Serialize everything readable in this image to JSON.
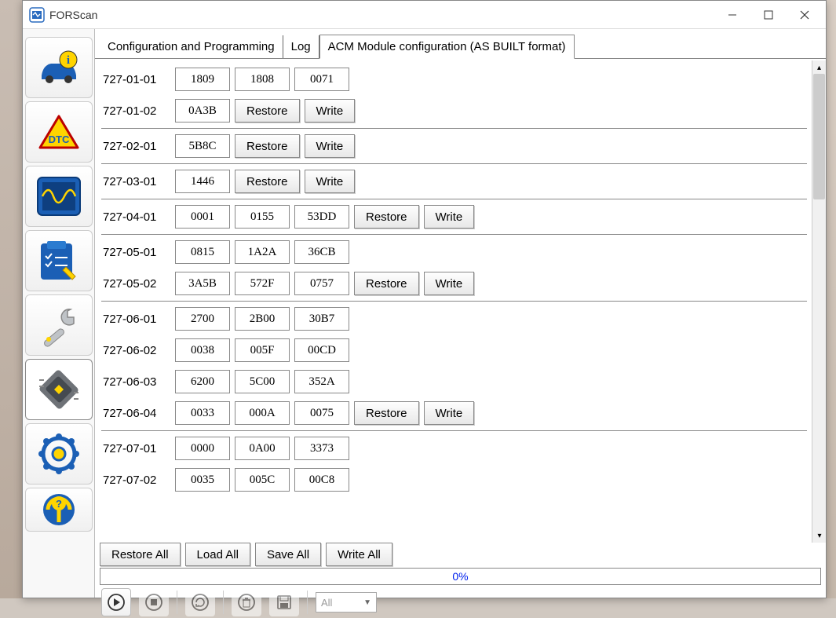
{
  "title": "FORScan",
  "tabs": {
    "config": "Configuration and Programming",
    "log": "Log",
    "acm": "ACM Module configuration (AS BUILT format)"
  },
  "rows": [
    {
      "addr": "727-01-01",
      "vals": [
        "1809",
        "1808",
        "0071"
      ],
      "buttons": []
    },
    {
      "addr": "727-01-02",
      "vals": [
        "0A3B"
      ],
      "buttons": [
        "Restore",
        "Write"
      ],
      "sep": true
    },
    {
      "addr": "727-02-01",
      "vals": [
        "5B8C"
      ],
      "buttons": [
        "Restore",
        "Write"
      ],
      "sep": true
    },
    {
      "addr": "727-03-01",
      "vals": [
        "1446"
      ],
      "buttons": [
        "Restore",
        "Write"
      ],
      "sep": true
    },
    {
      "addr": "727-04-01",
      "vals": [
        "0001",
        "0155",
        "53DD"
      ],
      "buttons": [
        "Restore",
        "Write"
      ],
      "sep": true
    },
    {
      "addr": "727-05-01",
      "vals": [
        "0815",
        "1A2A",
        "36CB"
      ],
      "buttons": []
    },
    {
      "addr": "727-05-02",
      "vals": [
        "3A5B",
        "572F",
        "0757"
      ],
      "buttons": [
        "Restore",
        "Write"
      ],
      "sep": true
    },
    {
      "addr": "727-06-01",
      "vals": [
        "2700",
        "2B00",
        "30B7"
      ],
      "buttons": []
    },
    {
      "addr": "727-06-02",
      "vals": [
        "0038",
        "005F",
        "00CD"
      ],
      "buttons": []
    },
    {
      "addr": "727-06-03",
      "vals": [
        "6200",
        "5C00",
        "352A"
      ],
      "buttons": []
    },
    {
      "addr": "727-06-04",
      "vals": [
        "0033",
        "000A",
        "0075"
      ],
      "buttons": [
        "Restore",
        "Write"
      ],
      "sep": true
    },
    {
      "addr": "727-07-01",
      "vals": [
        "0000",
        "0A00",
        "3373"
      ],
      "buttons": []
    },
    {
      "addr": "727-07-02",
      "vals": [
        "0035",
        "005C",
        "00C8"
      ],
      "buttons": []
    }
  ],
  "bottom": {
    "restore_all": "Restore All",
    "load_all": "Load All",
    "save_all": "Save All",
    "write_all": "Write All",
    "progress": "0%",
    "filter": "All"
  }
}
